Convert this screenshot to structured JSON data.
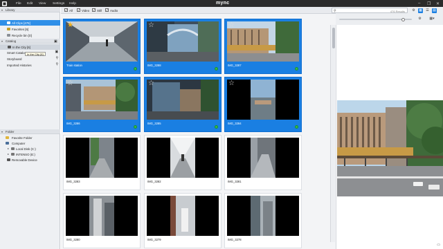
{
  "menubar": {
    "app_title": "mync",
    "menus": [
      "File",
      "Edit",
      "View",
      "Settings",
      "Help"
    ],
    "window_controls": [
      "–",
      "❐",
      "✕"
    ]
  },
  "sidebar": {
    "library": {
      "header": "Library",
      "items": [
        {
          "label": "All Clips [476]",
          "icon": "library-icon",
          "selected": true
        },
        {
          "label": "Favorites [6]",
          "icon": "star-icon"
        },
        {
          "label": "Recycle bin [0]",
          "icon": "trash-icon"
        }
      ]
    },
    "catalog": {
      "header": "Catalog",
      "items": [
        {
          "label": "In the City [6]",
          "icon": "film-icon",
          "selected": true
        },
        {
          "label": "Smart Catalog",
          "icon": "smart-catalog-icon"
        },
        {
          "label": "Storyboard",
          "icon": "storyboard-icon"
        },
        {
          "label": "Imported Histories",
          "icon": "history-icon"
        }
      ],
      "tooltip": "In the City [6]"
    },
    "folder": {
      "header": "Folder",
      "items": [
        {
          "label": "Favorite Folder",
          "icon": "folder-star-icon"
        },
        {
          "label": "Computer",
          "icon": "computer-icon"
        },
        {
          "label": "Local Disk (C:)",
          "icon": "disk-icon"
        },
        {
          "label": "INTENSO (E:)",
          "icon": "disk-icon"
        },
        {
          "label": "Removable Device",
          "icon": "usb-icon"
        }
      ]
    }
  },
  "filterbar": {
    "filters": [
      {
        "label": "All",
        "checked": true
      },
      {
        "label": "Video",
        "checked": true
      },
      {
        "label": "Still",
        "checked": true
      },
      {
        "label": "Audio",
        "checked": true
      }
    ]
  },
  "search": {
    "placeholder": "",
    "result_count": "476 Results"
  },
  "zoom_slider": {
    "value_fraction": 0.93
  },
  "clips": [
    {
      "name": "Train station",
      "selected": true,
      "starred": true,
      "status": "green"
    },
    {
      "name": "IMG_3288",
      "selected": true,
      "starred": false,
      "status": "green"
    },
    {
      "name": "IMG_3287",
      "selected": true,
      "starred": false,
      "status": "green"
    },
    {
      "name": "IMG_3286",
      "selected": true,
      "starred": false,
      "status": "green"
    },
    {
      "name": "IMG_3285",
      "selected": true,
      "starred": false,
      "status": "green"
    },
    {
      "name": "IMG_3284",
      "selected": true,
      "starred": false,
      "status": "green"
    },
    {
      "name": "IMG_3283",
      "selected": false,
      "starred": false
    },
    {
      "name": "IMG_3282",
      "selected": false,
      "starred": false
    },
    {
      "name": "IMG_3281",
      "selected": false,
      "starred": false
    },
    {
      "name": "IMG_3280",
      "selected": false,
      "starred": false
    },
    {
      "name": "IMG_3279",
      "selected": false,
      "starred": false
    },
    {
      "name": "IMG_3278",
      "selected": false,
      "starred": false
    }
  ],
  "colors": {
    "accent": "#1a7fe2",
    "sidebar_selected": "#2f8fe8",
    "status_green": "#2fbf4a",
    "star_gold": "#f2b21b",
    "menubar": "#2b2b2b"
  }
}
